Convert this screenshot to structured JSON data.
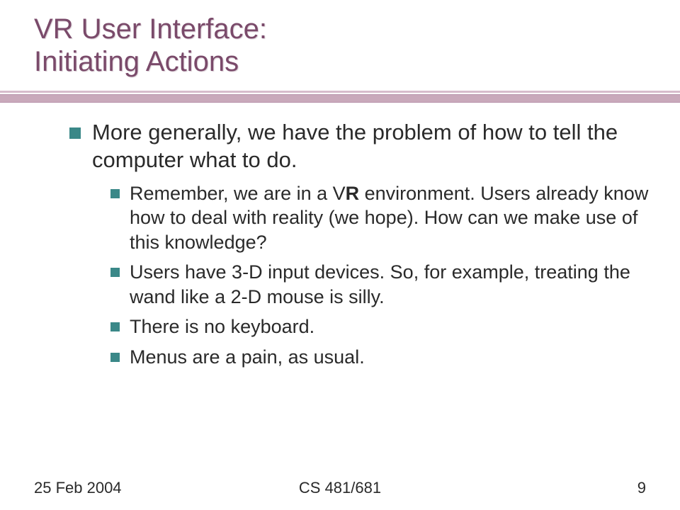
{
  "title": {
    "line1": "VR User Interface:",
    "line2": "Initiating Actions"
  },
  "bullets": {
    "lvl1_0": "More generally, we have the problem of how to tell the computer what to do.",
    "lvl2_0_pre": "Remember, we are in a V",
    "lvl2_0_bold": "R",
    "lvl2_0_post": " environment. Users already know how to deal with reality (we hope). How can we make use of this knowledge?",
    "lvl2_1": "Users have 3-D input devices. So, for example, treating the wand like a 2-D mouse is silly.",
    "lvl2_2": "There is no keyboard.",
    "lvl2_3": "Menus are a pain, as usual."
  },
  "footer": {
    "left": "25 Feb 2004",
    "center": "CS 481/681",
    "right": "9"
  }
}
